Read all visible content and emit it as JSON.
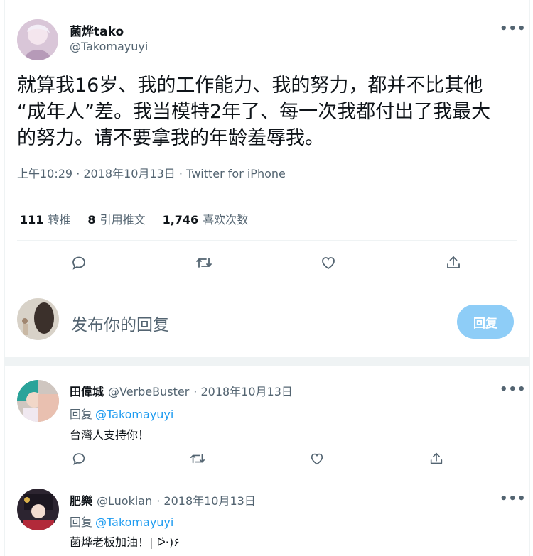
{
  "main_tweet": {
    "name": "菌烨tako",
    "handle": "@Takomayuyi",
    "text_lines": [
      "就算我16岁、我的工作能力、我的努力，都并不比其他",
      "“成年人”差。我当模特2年了、每一次我都付出了我最大",
      "的努力。请不要拿我的年龄羞辱我。"
    ],
    "meta": "上午10:29 · 2018年10月13日 · Twitter for iPhone",
    "stats": [
      {
        "count": "111",
        "label": "转推"
      },
      {
        "count": "8",
        "label": "引用推文"
      },
      {
        "count": "1,746",
        "label": "喜欢次数"
      }
    ],
    "more": "•••"
  },
  "composer": {
    "placeholder": "发布你的回复",
    "button": "回复"
  },
  "replies": [
    {
      "name": "田偉城",
      "handle": "@VerbeBuster",
      "date": "· 2018年10月13日",
      "reply_prefix": "回复",
      "reply_to": "@Takomayuyi",
      "text": "台灣人支持你！",
      "more": "•••"
    },
    {
      "name": "肥樂",
      "handle": "@Luokian",
      "date": "· 2018年10月13日",
      "reply_prefix": "回复",
      "reply_to": "@Takomayuyi",
      "text": "菌烨老板加油！| ᐅ̇·)۶",
      "more": "•••"
    }
  ],
  "icons": {
    "reply": "reply-icon",
    "retweet": "retweet-icon",
    "like": "heart-icon",
    "share": "share-icon"
  },
  "colors": {
    "text": "#0f1419",
    "secondary": "#536471",
    "link": "#1d9bf0",
    "reply_button": "#8ecdf7",
    "divider": "#eff3f4"
  }
}
